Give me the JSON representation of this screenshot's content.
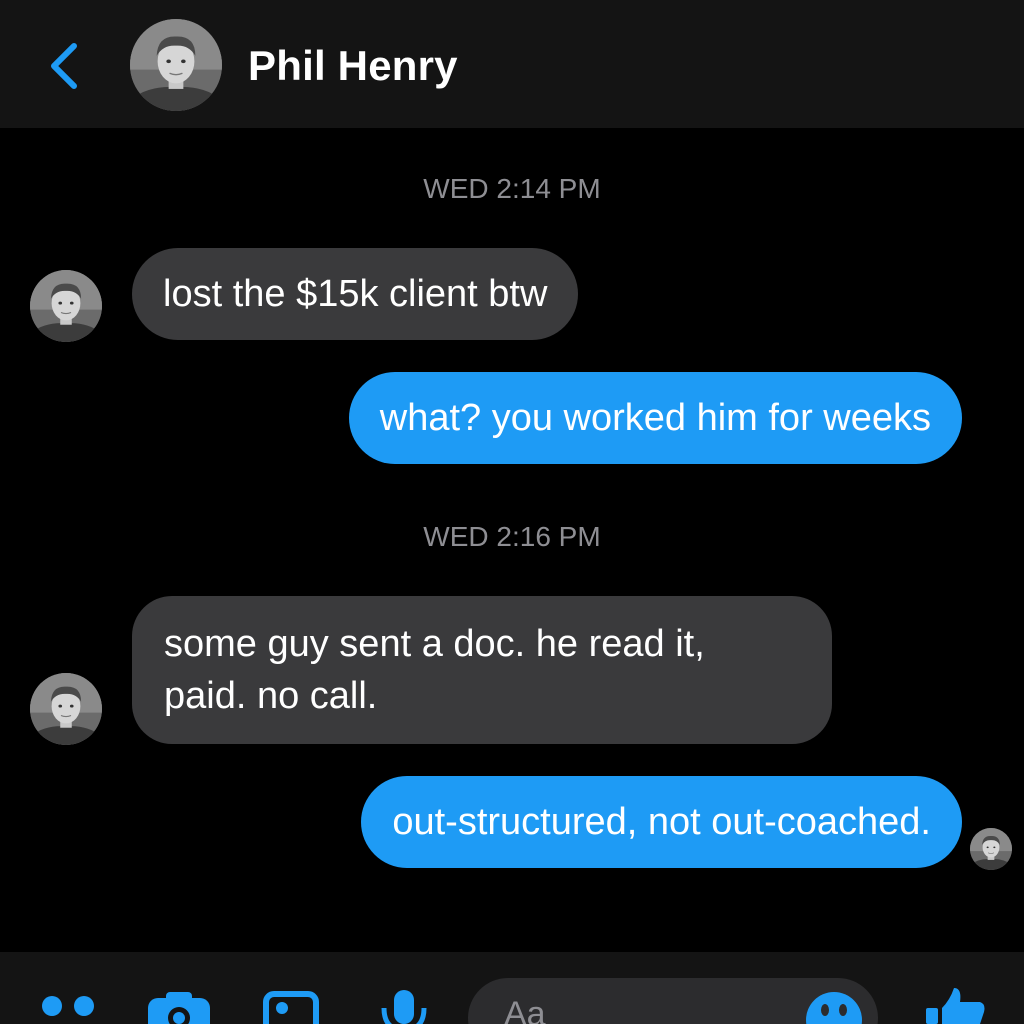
{
  "header": {
    "contact_name": "Phil Henry"
  },
  "messages": [
    {
      "type": "timestamp",
      "text": "WED 2:14 PM"
    },
    {
      "type": "incoming",
      "text": "lost the $15k client btw"
    },
    {
      "type": "outgoing",
      "text": "what? you worked him for weeks"
    },
    {
      "type": "timestamp",
      "text": "WED 2:16 PM"
    },
    {
      "type": "incoming",
      "text": "some guy sent a doc. he read it,\npaid. no call."
    },
    {
      "type": "outgoing",
      "text": "out-structured, not out-coached."
    }
  ],
  "composer": {
    "placeholder": "Aa",
    "icons": [
      "more-options-icon",
      "camera-icon",
      "gallery-icon",
      "microphone-icon",
      "emoji-icon",
      "thumbs-up-icon"
    ]
  },
  "colors": {
    "accent": "#1e9bf5",
    "incoming_bubble": "#3a3a3c",
    "background": "#000000",
    "header": "#141414",
    "timestamp": "#8e8e93"
  }
}
